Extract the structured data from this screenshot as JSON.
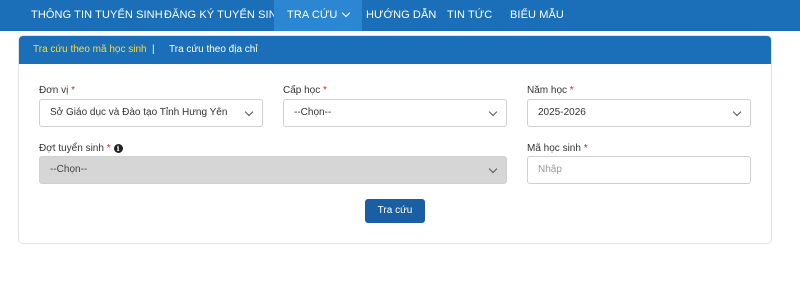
{
  "nav": {
    "items": [
      "THÔNG TIN TUYỂN SINH",
      "ĐĂNG KÝ TUYỂN SINH",
      "TRA CỨU",
      "HƯỚNG DẪN",
      "TIN TỨC",
      "BIỂU MẪU"
    ]
  },
  "tabs": {
    "by_student_code": "Tra cứu theo mã học sinh",
    "separator": "|",
    "by_address": "Tra cứu theo địa chỉ"
  },
  "form": {
    "unit": {
      "label": "Đơn vị",
      "required": "*",
      "value": "Sở Giáo dục và Đào tạo Tỉnh Hưng Yên"
    },
    "grade": {
      "label": "Cấp học",
      "required": "*",
      "value": "--Chọn--"
    },
    "year": {
      "label": "Năm học",
      "required": "*",
      "value": "2025-2026"
    },
    "round": {
      "label": "Đợt tuyển sinh",
      "required": "*",
      "value": "--Chọn--",
      "info_icon": "i"
    },
    "student_code": {
      "label": "Mã học sinh",
      "required": "*",
      "placeholder": "Nhập"
    },
    "submit": "Tra cứu"
  }
}
